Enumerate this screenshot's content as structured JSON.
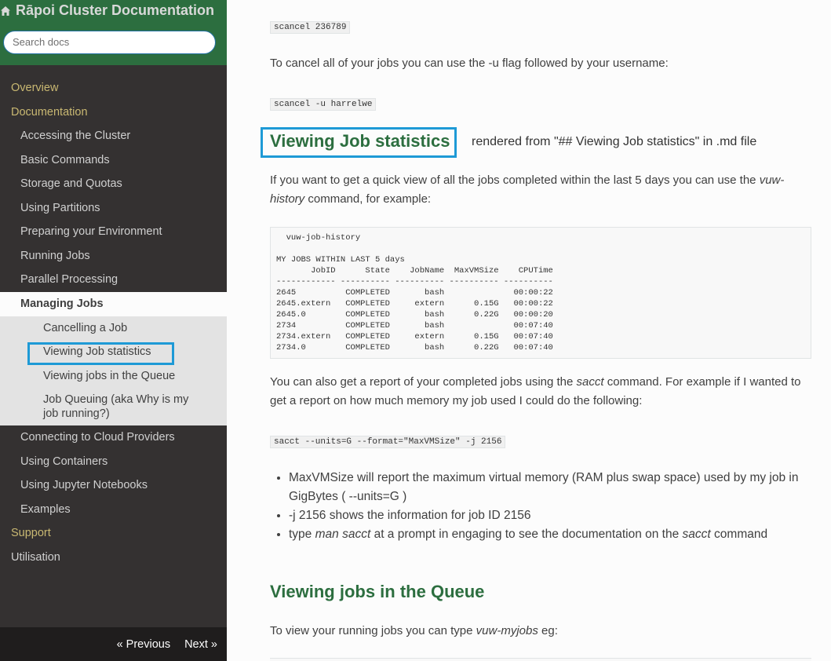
{
  "sidebar": {
    "title": "Rāpoi Cluster Documentation",
    "search_placeholder": "Search docs",
    "nav": {
      "overview": "Overview",
      "documentation": "Documentation",
      "items": [
        "Accessing the Cluster",
        "Basic Commands",
        "Storage and Quotas",
        "Using Partitions",
        "Preparing your Environment",
        "Running Jobs",
        "Parallel Processing"
      ],
      "current": "Managing Jobs",
      "sub_items": [
        "Cancelling a Job",
        "Viewing Job statistics",
        "Viewing jobs in the Queue",
        "Job Queuing (aka Why is my job running?)"
      ],
      "after_items": [
        "Connecting to Cloud Providers",
        "Using Containers",
        "Using Jupyter Notebooks",
        "Examples"
      ],
      "support": "Support",
      "utilisation": "Utilisation"
    },
    "footer": {
      "previous": "« Previous",
      "next": "Next »"
    }
  },
  "main": {
    "code1": "scancel 236789",
    "p_cancel_all": "To cancel all of your jobs you can use the -u flag followed by your username:",
    "code2": "scancel -u harrelwe",
    "heading1": "Viewing Job statistics",
    "annotation": "rendered from \"## Viewing Job statistics\" in .md file",
    "p_view1_a": "If you want to get a quick view of all the jobs completed within the last 5 days you can use the",
    "p_view1_em": "vuw-history",
    "p_view1_b": "command, for example:",
    "pre_block": "  vuw-job-history\n\nMY JOBS WITHIN LAST 5 days\n       JobID      State    JobName  MaxVMSize    CPUTime\n------------ ---------- ---------- ---------- ----------\n2645          COMPLETED       bash              00:00:22\n2645.extern   COMPLETED     extern      0.15G   00:00:22\n2645.0        COMPLETED       bash      0.22G   00:00:20\n2734          COMPLETED       bash              00:07:40\n2734.extern   COMPLETED     extern      0.15G   00:07:40\n2734.0        COMPLETED       bash      0.22G   00:07:40",
    "p_sacct_a": "You can also get a report of your completed jobs using the",
    "p_sacct_em": "sacct",
    "p_sacct_b": "command. For example if I wanted to get a report on how much memory my job used I could do the following:",
    "code3": "sacct --units=G --format=\"MaxVMSize\" -j 2156",
    "bullet1": "MaxVMSize will report the maximum virtual memory (RAM plus swap space) used by my job in GigBytes ( --units=G )",
    "bullet2": "-j 2156 shows the information for job ID 2156",
    "bullet3_a": "type",
    "bullet3_em1": "man sacct",
    "bullet3_b": "at a prompt in engaging to see the documentation on the",
    "bullet3_em2": "sacct",
    "bullet3_c": "command",
    "heading2": "Viewing jobs in the Queue",
    "p_queue_a": "To view your running jobs you can type",
    "p_queue_em": "vuw-myjobs",
    "p_queue_b": "eg:"
  },
  "colors": {
    "sidebar_bg": "#343131",
    "header_green": "#2c6e3f",
    "highlight_blue": "#1e9ad6",
    "heading_green": "#2c6e3f"
  }
}
